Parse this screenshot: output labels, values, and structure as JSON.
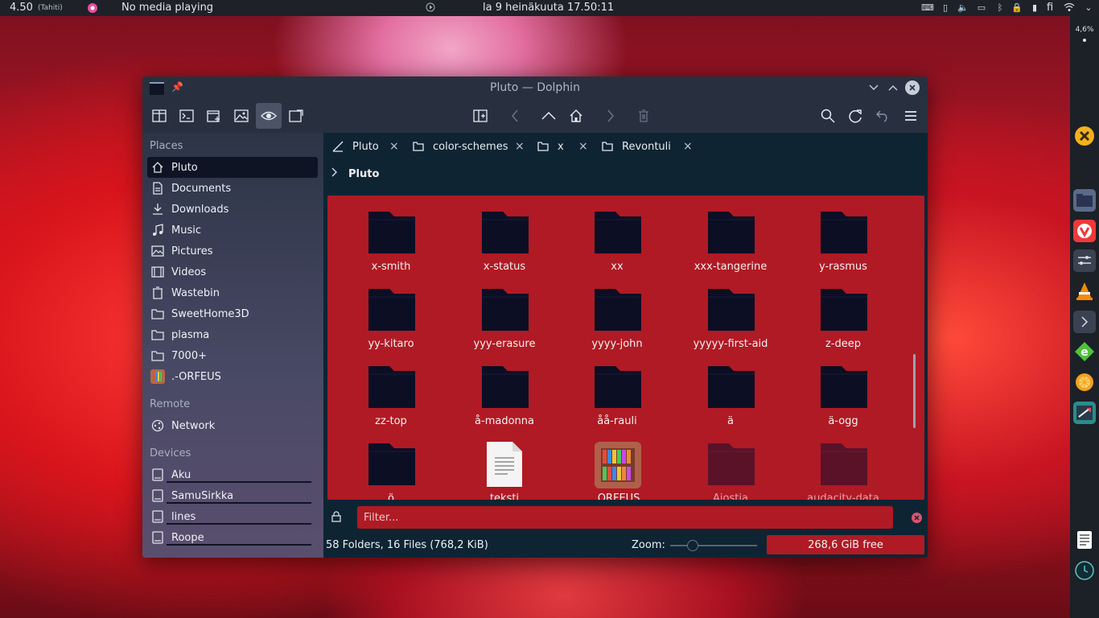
{
  "top_panel": {
    "clock_small": "4.50",
    "timezone": "(Tahiti)",
    "media": "No media playing",
    "datetime": "la 9 heinäkuuta 17.50:11",
    "lang": "fi"
  },
  "dock": {
    "cpu": "4,6%"
  },
  "window": {
    "title": "Pluto — Dolphin"
  },
  "sidebar": {
    "places_heading": "Places",
    "places": [
      {
        "label": "Pluto",
        "icon": "home-icon"
      },
      {
        "label": "Documents",
        "icon": "documents-icon"
      },
      {
        "label": "Downloads",
        "icon": "downloads-icon"
      },
      {
        "label": "Music",
        "icon": "music-icon"
      },
      {
        "label": "Pictures",
        "icon": "pictures-icon"
      },
      {
        "label": "Videos",
        "icon": "videos-icon"
      },
      {
        "label": "Wastebin",
        "icon": "wastebin-icon"
      },
      {
        "label": "SweetHome3D",
        "icon": "folder-icon"
      },
      {
        "label": "plasma",
        "icon": "folder-icon"
      },
      {
        "label": "7000+",
        "icon": "folder-icon"
      },
      {
        "label": ".-ORFEUS",
        "icon": "orfeus-icon"
      }
    ],
    "remote_heading": "Remote",
    "remote": [
      {
        "label": "Network",
        "icon": "network-icon"
      }
    ],
    "devices_heading": "Devices",
    "devices": [
      {
        "label": "Aku",
        "icon": "drive-icon"
      },
      {
        "label": "SamuSirkka",
        "icon": "drive-icon"
      },
      {
        "label": "lines",
        "icon": "drive-icon"
      },
      {
        "label": "Roope",
        "icon": "drive-icon"
      }
    ]
  },
  "tabs": [
    {
      "label": "Pluto",
      "icon": "pluto-tab-icon",
      "close": "×"
    },
    {
      "label": "color-schemes",
      "icon": "folder-icon",
      "close": "×"
    },
    {
      "label": "x",
      "icon": "folder-icon",
      "close": "×"
    },
    {
      "label": "Revontuli",
      "icon": "folder-icon",
      "close": "×"
    }
  ],
  "breadcrumb": {
    "current": "Pluto"
  },
  "files": [
    {
      "name": "x-smith",
      "kind": "folder"
    },
    {
      "name": "x-status",
      "kind": "folder"
    },
    {
      "name": "xx",
      "kind": "folder"
    },
    {
      "name": "xxx-tangerine",
      "kind": "folder"
    },
    {
      "name": "y-rasmus",
      "kind": "folder"
    },
    {
      "name": "yy-kitaro",
      "kind": "folder"
    },
    {
      "name": "yyy-erasure",
      "kind": "folder"
    },
    {
      "name": "yyyy-john",
      "kind": "folder"
    },
    {
      "name": "yyyyy-first-aid",
      "kind": "folder"
    },
    {
      "name": "z-deep",
      "kind": "folder"
    },
    {
      "name": "zz-top",
      "kind": "folder"
    },
    {
      "name": "å-madonna",
      "kind": "folder"
    },
    {
      "name": "åå-rauli",
      "kind": "folder"
    },
    {
      "name": "ä",
      "kind": "folder"
    },
    {
      "name": "ä-ogg",
      "kind": "folder"
    },
    {
      "name": "ö",
      "kind": "folder"
    },
    {
      "name": "teksti",
      "kind": "text"
    },
    {
      "name": ".ORFEUS",
      "kind": "orfeus"
    },
    {
      "name": "Aiostia",
      "kind": "hidden-folder"
    },
    {
      "name": "audacity-data",
      "kind": "hidden-folder"
    }
  ],
  "filter": {
    "placeholder": "Filter..."
  },
  "status": {
    "summary": "58 Folders, 16 Files (768,2 KiB)",
    "zoom_label": "Zoom:",
    "free": "268,6 GiB free",
    "zoom_level": 0.25
  },
  "colors": {
    "accent": "#b01a24",
    "sidebar_active": "#0e1424",
    "main_bg": "#0f2433"
  }
}
